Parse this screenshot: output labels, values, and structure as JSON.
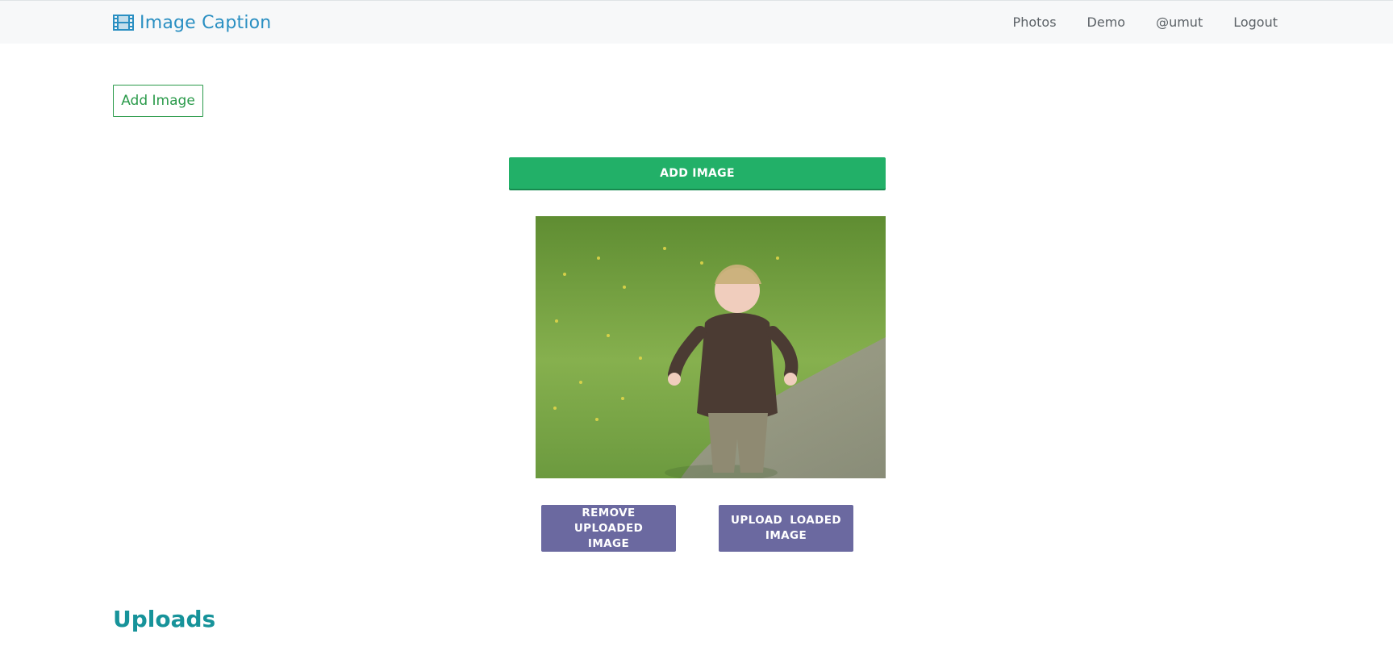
{
  "navbar": {
    "brand_icon": "film-icon",
    "brand_title": "Image Caption",
    "links": [
      "Photos",
      "Demo",
      "@umut",
      "Logout"
    ]
  },
  "actions": {
    "add_image_outline": "Add Image",
    "add_image_primary": "ADD IMAGE",
    "remove_uploaded": "REMOVE UPLOADED IMAGE",
    "upload_loaded": "UPLOAD LOADED IMAGE"
  },
  "preview": {
    "image_semantic": "photo-preview"
  },
  "uploads": {
    "title": "Uploads"
  },
  "colors": {
    "brand": "#2a8fc2",
    "primary_green": "#22b068",
    "outline_green": "#2a9a4a",
    "action_purple": "#6b69a0",
    "uploads_teal": "#17939a"
  }
}
